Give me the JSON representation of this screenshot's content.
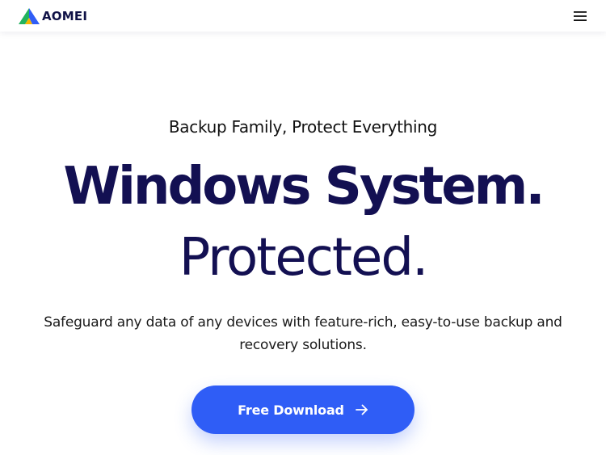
{
  "header": {
    "logo_text": "AOMEI",
    "menu_icon": "hamburger-menu-icon"
  },
  "hero": {
    "eyebrow": "Backup Family, Protect Everything",
    "headline_line1": "Windows System.",
    "headline_line2": "Protected.",
    "description": "Safeguard any data of any devices with feature-rich, easy-to-use backup and recovery solutions.",
    "cta_label": "Free Download",
    "cta_icon": "arrow-right-icon"
  },
  "colors": {
    "headline": "#131052",
    "cta_background": "#2f5df6",
    "cta_text": "#ffffff",
    "logo_blue": "#2f5df6",
    "logo_green": "#22b35e",
    "logo_yellow": "#f5b400"
  }
}
